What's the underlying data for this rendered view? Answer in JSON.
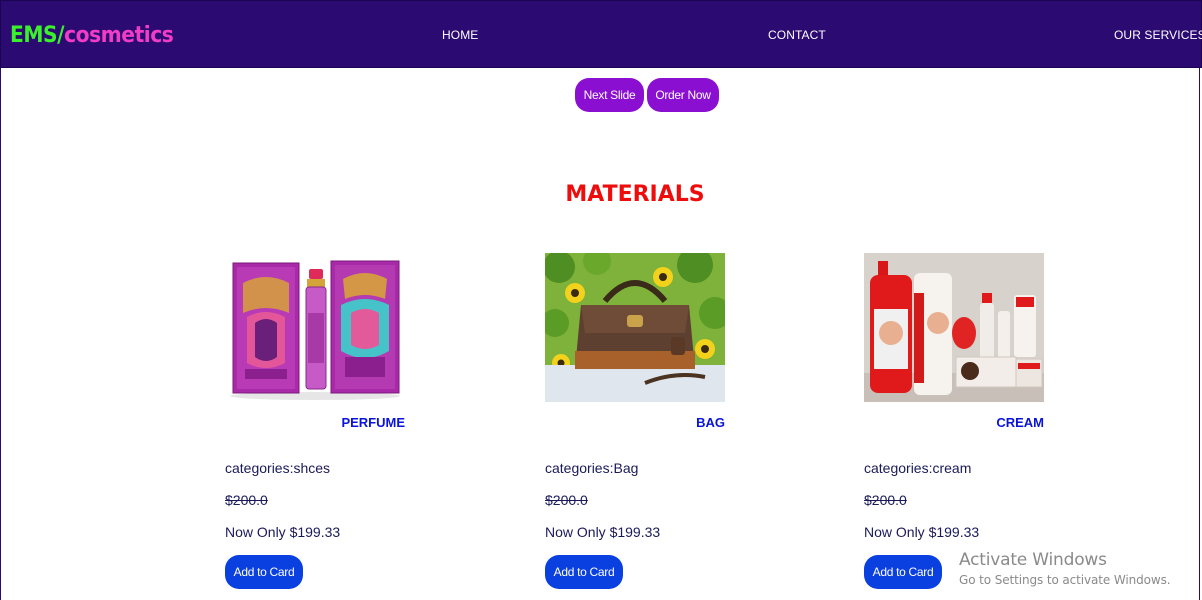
{
  "header": {
    "brand_part1": "EMS/",
    "brand_part2": "cosmetics",
    "nav": {
      "home": "HOME",
      "contact": "CONTACT",
      "services": "OUR SERVICES"
    },
    "colors": {
      "bar": "#2b0a72",
      "brand_green": "#3af12b",
      "brand_pink": "#f03cc6"
    }
  },
  "hero": {
    "next_label": "Next Slide",
    "order_label": "Order Now",
    "button_color": "#8a0fd1"
  },
  "section": {
    "title": "MATERIALS",
    "title_color": "#ee0d0d"
  },
  "products": [
    {
      "name": "PERFUME",
      "category": "categories:shces",
      "old_price": "$200.0",
      "new_price": "Now Only $199.33",
      "button": "Add to Card",
      "image_icon": "perfume-box-image"
    },
    {
      "name": "BAG",
      "category": "categories:Bag",
      "old_price": "$200.0",
      "new_price": "Now Only $199.33",
      "button": "Add to Card",
      "image_icon": "handbag-image"
    },
    {
      "name": "CREAM",
      "category": "categories:cream",
      "old_price": "$200.0",
      "new_price": "Now Only $199.33",
      "button": "Add to Card",
      "image_icon": "cream-bottles-image"
    }
  ],
  "watermark": {
    "title": "Activate Windows",
    "subtitle": "Go to Settings to activate Windows."
  }
}
